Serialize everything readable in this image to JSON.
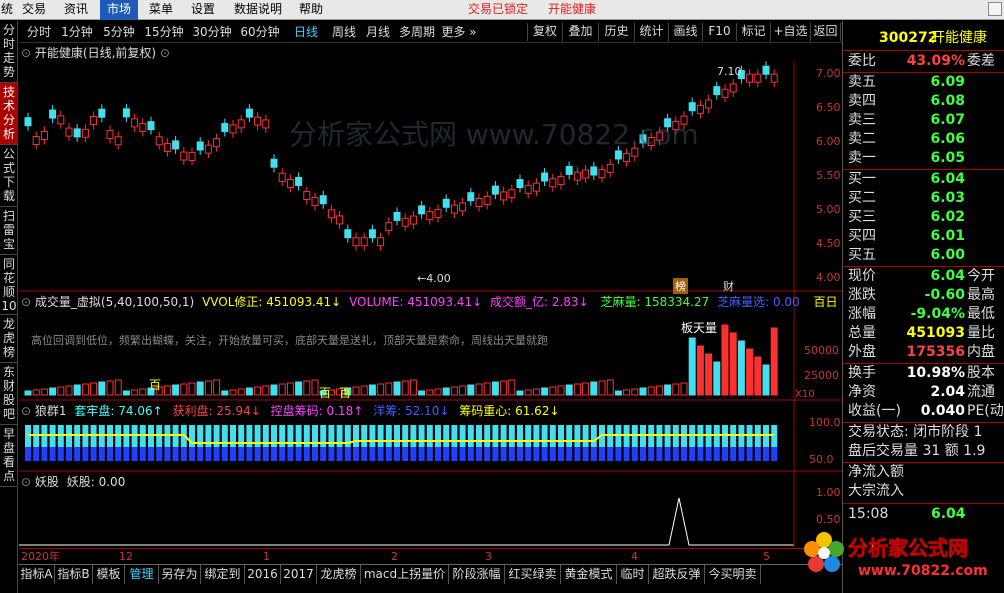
{
  "menubar": {
    "items": [
      "系统",
      "交易",
      "资讯",
      "市场",
      "菜单",
      "设置",
      "数据说明",
      "帮助"
    ],
    "active": "市场",
    "alerts": [
      "交易已锁定",
      "开能健康"
    ]
  },
  "sidebar_tabs": [
    "分时走势",
    "技术分析",
    "公式下载",
    "扫雷宝",
    "同花顺10",
    "龙虎榜",
    "东财股吧",
    "早盘看点"
  ],
  "sidebar_active": 1,
  "toolbar": {
    "timeframes": [
      "分时",
      "1分钟",
      "5分钟",
      "15分钟",
      "30分钟",
      "60分钟",
      "日线",
      "周线",
      "月线",
      "多周期",
      "更多"
    ],
    "selected": "日线",
    "buttons": [
      "复权",
      "叠加",
      "历史",
      "统计",
      "画线",
      "F10",
      "标记",
      "+自选",
      "返回"
    ]
  },
  "main_title": "开能健康(日线,前复权)",
  "price_axis": [
    "7.00",
    "6.50",
    "6.00",
    "5.50",
    "5.00",
    "4.50",
    "4.00"
  ],
  "price_marks": {
    "high": "7.10",
    "low": "4.00",
    "bang": "榜",
    "cai": "财"
  },
  "watermark": "分析家公式网 www.70822.com",
  "vol_panel": {
    "title": "成交量_虚拟(5,40,100,50,1)",
    "items": [
      {
        "label": "VVOL修正:",
        "value": "451093.41↓",
        "color": "#ffff00"
      },
      {
        "label": "VOLUME:",
        "value": "451093.41↓",
        "color": "#ff40ff"
      },
      {
        "label": "成交额_亿:",
        "value": "2.83↓",
        "color": "#ff40ff"
      },
      {
        "label": "芝麻量:",
        "value": "158334.27",
        "color": "#40ff40"
      },
      {
        "label": "芝麻量选:",
        "value": "0.00",
        "color": "#4060ff"
      },
      {
        "label": "百日",
        "value": "",
        "color": "#ffff00"
      }
    ],
    "note": "高位回调到低位，频繁出蝴蝶，关注，开始放量可买，底部天量是送礼，顶部天量是索命，周线出天量就跑",
    "axis": [
      "50000",
      "25000",
      "X10"
    ],
    "tag_tianliang": "板天量",
    "tag_bai": "百"
  },
  "wolf_panel": {
    "title": "狼群1",
    "items": [
      {
        "label": "套牢盘:",
        "value": "74.06↑",
        "color": "#40ffff"
      },
      {
        "label": "获利盘:",
        "value": "25.94↓",
        "color": "#ff4040"
      },
      {
        "label": "控盘筹码:",
        "value": "0.18↑",
        "color": "#ff40ff"
      },
      {
        "label": "洋筹:",
        "value": "52.10↓",
        "color": "#4060ff"
      },
      {
        "label": "筹码重心:",
        "value": "61.62↓",
        "color": "#ffff00"
      }
    ],
    "axis": [
      "100.0",
      "50.0"
    ]
  },
  "yao_panel": {
    "title": "妖股",
    "label": "妖股:",
    "value": "0.00",
    "axis": [
      "1.00",
      "0.50"
    ]
  },
  "date_axis": [
    {
      "label": "2020年"
    },
    {
      "label": "12"
    },
    {
      "label": "1"
    },
    {
      "label": "2"
    },
    {
      "label": "3"
    },
    {
      "label": "4"
    },
    {
      "label": "5"
    }
  ],
  "bottom_tabs": [
    "指标A",
    "指标B",
    "模板",
    "管理",
    "另存为",
    "绑定到",
    "2016",
    "2017",
    "龙虎榜",
    "macd上拐量价",
    "阶段涨幅",
    "红买绿卖",
    "黄金模式",
    "临时",
    "超跌反弹",
    "今买明卖"
  ],
  "bottom_active": "管理",
  "quote": {
    "code": "300272",
    "name": "开能健康",
    "weibi": {
      "label": "委比",
      "value": "43.09%",
      "right": "委差"
    },
    "sell": [
      {
        "label": "卖五",
        "value": "6.09"
      },
      {
        "label": "卖四",
        "value": "6.08"
      },
      {
        "label": "卖三",
        "value": "6.07"
      },
      {
        "label": "卖二",
        "value": "6.06"
      },
      {
        "label": "卖一",
        "value": "6.05"
      }
    ],
    "buy": [
      {
        "label": "买一",
        "value": "6.04"
      },
      {
        "label": "买二",
        "value": "6.03"
      },
      {
        "label": "买三",
        "value": "6.02"
      },
      {
        "label": "买四",
        "value": "6.01"
      },
      {
        "label": "买五",
        "value": "6.00"
      }
    ],
    "stats": [
      {
        "label": "现价",
        "value": "6.04",
        "right": "今开",
        "color": "#40ff40"
      },
      {
        "label": "涨跌",
        "value": "-0.60",
        "right": "最高",
        "color": "#40ff40"
      },
      {
        "label": "涨幅",
        "value": "-9.04%",
        "right": "最低",
        "color": "#40ff40"
      },
      {
        "label": "总量",
        "value": "451093",
        "right": "量比",
        "color": "#ffff00"
      },
      {
        "label": "外盘",
        "value": "175356",
        "right": "内盘",
        "color": "#ff4040"
      }
    ],
    "stats2": [
      {
        "label": "换手",
        "value": "10.98%",
        "right": "股本",
        "color": "#ffffff"
      },
      {
        "label": "净资",
        "value": "2.04",
        "right": "流通",
        "color": "#ffffff"
      },
      {
        "label": "收益(一)",
        "value": "0.040",
        "right": "PE(动",
        "color": "#ffffff"
      }
    ],
    "status": [
      "交易状态: 闭市阶段 1",
      "盘后交易量 31 额 1.9"
    ],
    "flow": [
      {
        "label": "净流入额",
        "value": ""
      },
      {
        "label": "大宗流入",
        "value": ""
      }
    ],
    "tick": {
      "time": "15:08",
      "price": "6.04"
    }
  },
  "logo_text": "分析家公式网",
  "logo_url": "www.70822.com"
}
